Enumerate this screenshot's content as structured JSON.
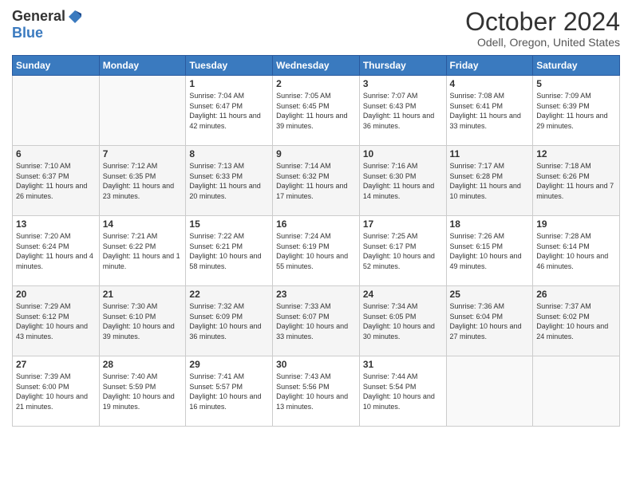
{
  "header": {
    "logo_general": "General",
    "logo_blue": "Blue",
    "month_title": "October 2024",
    "location": "Odell, Oregon, United States"
  },
  "days_of_week": [
    "Sunday",
    "Monday",
    "Tuesday",
    "Wednesday",
    "Thursday",
    "Friday",
    "Saturday"
  ],
  "weeks": [
    [
      {
        "day": "",
        "info": ""
      },
      {
        "day": "",
        "info": ""
      },
      {
        "day": "1",
        "info": "Sunrise: 7:04 AM\nSunset: 6:47 PM\nDaylight: 11 hours and 42 minutes."
      },
      {
        "day": "2",
        "info": "Sunrise: 7:05 AM\nSunset: 6:45 PM\nDaylight: 11 hours and 39 minutes."
      },
      {
        "day": "3",
        "info": "Sunrise: 7:07 AM\nSunset: 6:43 PM\nDaylight: 11 hours and 36 minutes."
      },
      {
        "day": "4",
        "info": "Sunrise: 7:08 AM\nSunset: 6:41 PM\nDaylight: 11 hours and 33 minutes."
      },
      {
        "day": "5",
        "info": "Sunrise: 7:09 AM\nSunset: 6:39 PM\nDaylight: 11 hours and 29 minutes."
      }
    ],
    [
      {
        "day": "6",
        "info": "Sunrise: 7:10 AM\nSunset: 6:37 PM\nDaylight: 11 hours and 26 minutes."
      },
      {
        "day": "7",
        "info": "Sunrise: 7:12 AM\nSunset: 6:35 PM\nDaylight: 11 hours and 23 minutes."
      },
      {
        "day": "8",
        "info": "Sunrise: 7:13 AM\nSunset: 6:33 PM\nDaylight: 11 hours and 20 minutes."
      },
      {
        "day": "9",
        "info": "Sunrise: 7:14 AM\nSunset: 6:32 PM\nDaylight: 11 hours and 17 minutes."
      },
      {
        "day": "10",
        "info": "Sunrise: 7:16 AM\nSunset: 6:30 PM\nDaylight: 11 hours and 14 minutes."
      },
      {
        "day": "11",
        "info": "Sunrise: 7:17 AM\nSunset: 6:28 PM\nDaylight: 11 hours and 10 minutes."
      },
      {
        "day": "12",
        "info": "Sunrise: 7:18 AM\nSunset: 6:26 PM\nDaylight: 11 hours and 7 minutes."
      }
    ],
    [
      {
        "day": "13",
        "info": "Sunrise: 7:20 AM\nSunset: 6:24 PM\nDaylight: 11 hours and 4 minutes."
      },
      {
        "day": "14",
        "info": "Sunrise: 7:21 AM\nSunset: 6:22 PM\nDaylight: 11 hours and 1 minute."
      },
      {
        "day": "15",
        "info": "Sunrise: 7:22 AM\nSunset: 6:21 PM\nDaylight: 10 hours and 58 minutes."
      },
      {
        "day": "16",
        "info": "Sunrise: 7:24 AM\nSunset: 6:19 PM\nDaylight: 10 hours and 55 minutes."
      },
      {
        "day": "17",
        "info": "Sunrise: 7:25 AM\nSunset: 6:17 PM\nDaylight: 10 hours and 52 minutes."
      },
      {
        "day": "18",
        "info": "Sunrise: 7:26 AM\nSunset: 6:15 PM\nDaylight: 10 hours and 49 minutes."
      },
      {
        "day": "19",
        "info": "Sunrise: 7:28 AM\nSunset: 6:14 PM\nDaylight: 10 hours and 46 minutes."
      }
    ],
    [
      {
        "day": "20",
        "info": "Sunrise: 7:29 AM\nSunset: 6:12 PM\nDaylight: 10 hours and 43 minutes."
      },
      {
        "day": "21",
        "info": "Sunrise: 7:30 AM\nSunset: 6:10 PM\nDaylight: 10 hours and 39 minutes."
      },
      {
        "day": "22",
        "info": "Sunrise: 7:32 AM\nSunset: 6:09 PM\nDaylight: 10 hours and 36 minutes."
      },
      {
        "day": "23",
        "info": "Sunrise: 7:33 AM\nSunset: 6:07 PM\nDaylight: 10 hours and 33 minutes."
      },
      {
        "day": "24",
        "info": "Sunrise: 7:34 AM\nSunset: 6:05 PM\nDaylight: 10 hours and 30 minutes."
      },
      {
        "day": "25",
        "info": "Sunrise: 7:36 AM\nSunset: 6:04 PM\nDaylight: 10 hours and 27 minutes."
      },
      {
        "day": "26",
        "info": "Sunrise: 7:37 AM\nSunset: 6:02 PM\nDaylight: 10 hours and 24 minutes."
      }
    ],
    [
      {
        "day": "27",
        "info": "Sunrise: 7:39 AM\nSunset: 6:00 PM\nDaylight: 10 hours and 21 minutes."
      },
      {
        "day": "28",
        "info": "Sunrise: 7:40 AM\nSunset: 5:59 PM\nDaylight: 10 hours and 19 minutes."
      },
      {
        "day": "29",
        "info": "Sunrise: 7:41 AM\nSunset: 5:57 PM\nDaylight: 10 hours and 16 minutes."
      },
      {
        "day": "30",
        "info": "Sunrise: 7:43 AM\nSunset: 5:56 PM\nDaylight: 10 hours and 13 minutes."
      },
      {
        "day": "31",
        "info": "Sunrise: 7:44 AM\nSunset: 5:54 PM\nDaylight: 10 hours and 10 minutes."
      },
      {
        "day": "",
        "info": ""
      },
      {
        "day": "",
        "info": ""
      }
    ]
  ]
}
